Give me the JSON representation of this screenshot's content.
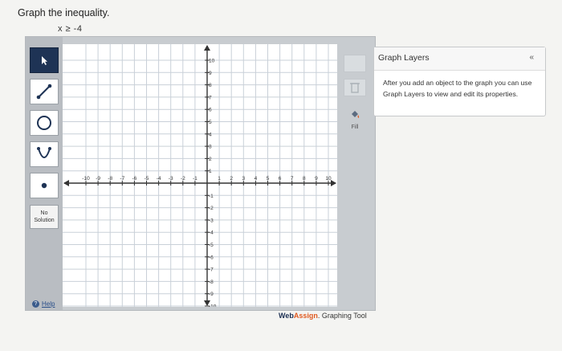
{
  "question": {
    "prompt": "Graph the inequality.",
    "inequality": "x ≥ -4"
  },
  "toolbar": {
    "tools": [
      {
        "name": "pointer-tool",
        "icon": "arrow-pointer-icon",
        "active": true
      },
      {
        "name": "line-tool",
        "icon": "line-segment-icon",
        "active": false
      },
      {
        "name": "circle-tool",
        "icon": "circle-icon",
        "active": false
      },
      {
        "name": "parabola-tool",
        "icon": "parabola-icon",
        "active": false
      },
      {
        "name": "point-tool",
        "icon": "point-icon",
        "active": false
      }
    ],
    "no_solution_line1": "No",
    "no_solution_line2": "Solution",
    "help_label": "Help"
  },
  "graph": {
    "x_ticks": [
      "-10",
      "-9",
      "-8",
      "-7",
      "-6",
      "-5",
      "-4",
      "-3",
      "-2",
      "-1",
      "1",
      "2",
      "3",
      "4",
      "5",
      "6",
      "7",
      "8",
      "9",
      "10"
    ],
    "y_ticks_top": [
      "10",
      "9",
      "8",
      "7",
      "6",
      "5",
      "4",
      "3",
      "2",
      "1"
    ],
    "y_ticks_bottom": [
      "-1",
      "-2",
      "-3",
      "-4",
      "-5",
      "-6",
      "-7",
      "-8",
      "-9",
      "-10"
    ],
    "xlim": [
      -10,
      10
    ],
    "ylim": [
      -10,
      10
    ]
  },
  "side_tools": {
    "fill_label": "Fill"
  },
  "layers": {
    "title": "Graph Layers",
    "collapse_symbol": "«",
    "description": "After you add an object to the graph you can use Graph Layers to view and edit its properties."
  },
  "brand": {
    "web": "Web",
    "assign": "Assign",
    "rest": ". Graphing Tool"
  },
  "colors": {
    "active_tool": "#1e3355",
    "grid_line": "#c9d0d8",
    "axis": "#333333",
    "brand_orange": "#e05a21"
  }
}
